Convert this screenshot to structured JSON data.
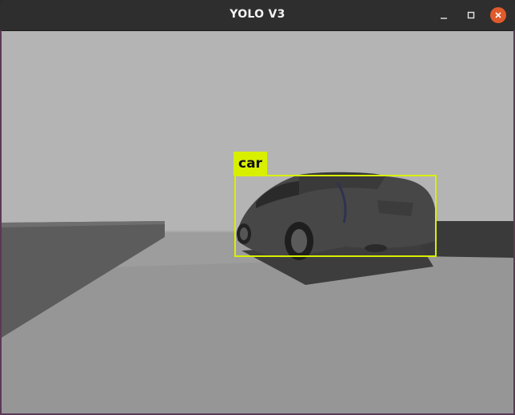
{
  "window": {
    "title": "YOLO V3",
    "controls": {
      "minimize": "minimize-icon",
      "maximize": "maximize-icon",
      "close": "close-icon"
    },
    "close_color": "#e05a2b"
  },
  "detections": [
    {
      "label": "car",
      "color": "#d8f000"
    }
  ]
}
